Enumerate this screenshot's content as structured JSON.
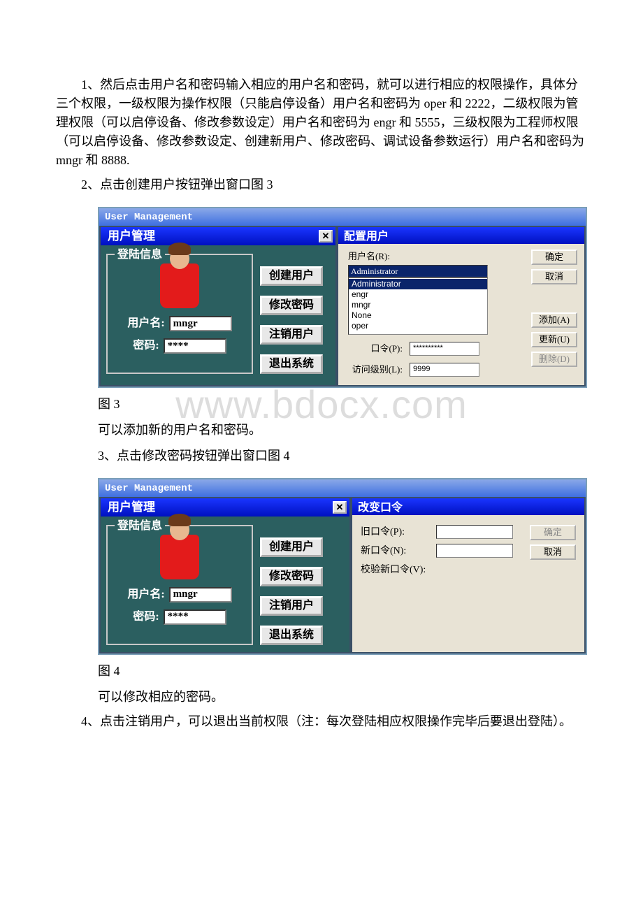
{
  "document": {
    "para1": "1、然后点击用户名和密码输入相应的用户名和密码，就可以进行相应的权限操作，具体分三个权限，一级权限为操作权限（只能启停设备）用户名和密码为 oper 和 2222，二级权限为管理权限（可以启停设备、修改参数设定）用户名和密码为 engr 和 5555，三级权限为工程师权限（可以启停设备、修改参数设定、创建新用户、修改密码、调试设备参数运行）用户名和密码为 mngr 和 8888.",
    "para2": "2、点击创建用户按钮弹出窗口图 3",
    "fig3_caption": "图 3",
    "para3": "可以添加新的用户名和密码。",
    "para4": "3、点击修改密码按钮弹出窗口图 4",
    "fig4_caption": "图 4",
    "para5": "可以修改相应的密码。",
    "para6": "4、点击注销用户，可以退出当前权限（注：每次登陆相应权限操作完毕后要退出登陆）。",
    "watermark": "www.bdocx.com"
  },
  "fig3": {
    "outer_title": "User  Management",
    "left": {
      "titlebar": "用户管理",
      "close": "✕",
      "legend": "登陆信息",
      "username_label": "用户名:",
      "username_value": "mngr",
      "password_label": "密码:",
      "password_value": "****",
      "buttons": [
        "创建用户",
        "修改密码",
        "注销用户",
        "退出系统"
      ]
    },
    "right": {
      "titlebar": "配置用户",
      "username_label": "用户名(R):",
      "username_value": "Administrator",
      "list": [
        "Administrator",
        "engr",
        "mngr",
        "None",
        "oper"
      ],
      "password_label": "口令(P):",
      "password_value": "**********",
      "level_label": "访问级别(L):",
      "level_value": "9999",
      "buttons": {
        "ok": "确定",
        "cancel": "取消",
        "add": "添加(A)",
        "update": "更新(U)",
        "delete": "删除(D)"
      }
    }
  },
  "fig4": {
    "outer_title": "User  Management",
    "left": {
      "titlebar": "用户管理",
      "close": "✕",
      "legend": "登陆信息",
      "username_label": "用户名:",
      "username_value": "mngr",
      "password_label": "密码:",
      "password_value": "****",
      "buttons": [
        "创建用户",
        "修改密码",
        "注销用户",
        "退出系统"
      ]
    },
    "right": {
      "titlebar": "改变口令",
      "old_label": "旧口令(P):",
      "new_label": "新口令(N):",
      "verify_label": "校验新口令(V):",
      "buttons": {
        "ok": "确定",
        "cancel": "取消"
      }
    }
  }
}
